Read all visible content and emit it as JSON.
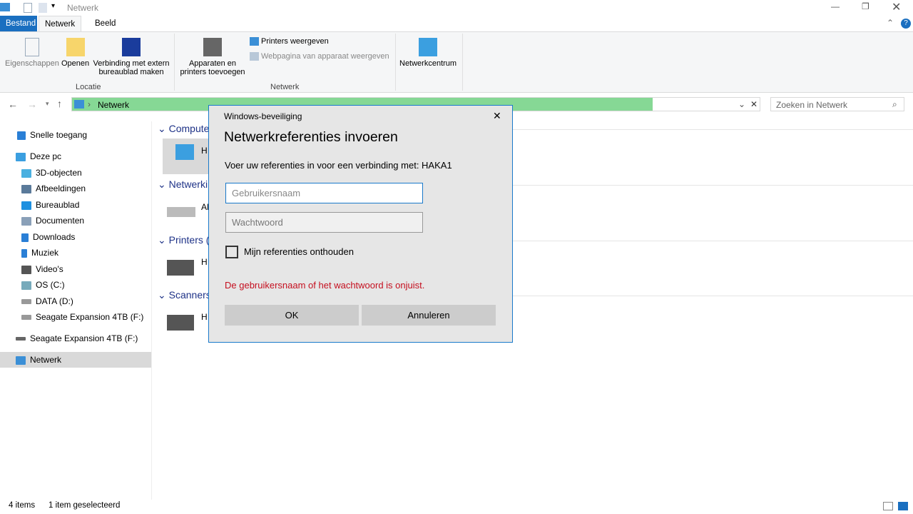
{
  "window": {
    "title": "Netwerk"
  },
  "tabs": [
    {
      "label": "Bestand"
    },
    {
      "label": "Netwerk"
    },
    {
      "label": "Beeld"
    }
  ],
  "ribbon": {
    "locatie": {
      "label": "Locatie",
      "buttons": [
        {
          "label": "Eigenschappen"
        },
        {
          "label": "Openen"
        },
        {
          "label": "Verbinding met extern bureaublad maken"
        }
      ]
    },
    "netwerk": {
      "label": "Netwerk",
      "add_devices": "Apparaten en printers toevoegen",
      "show_printers": "Printers weergeven",
      "device_webpage": "Webpagina van apparaat weergeven"
    },
    "netwerkcentrum": "Netwerkcentrum"
  },
  "address": {
    "path": "Netwerk",
    "search_placeholder": "Zoeken in Netwerk"
  },
  "sidebar": {
    "items": [
      {
        "label": "Snelle toegang"
      },
      {
        "label": "Deze pc"
      },
      {
        "label": "3D-objecten"
      },
      {
        "label": "Afbeeldingen"
      },
      {
        "label": "Bureaublad"
      },
      {
        "label": "Documenten"
      },
      {
        "label": "Downloads"
      },
      {
        "label": "Muziek"
      },
      {
        "label": "Video's"
      },
      {
        "label": "OS (C:)"
      },
      {
        "label": "DATA (D:)"
      },
      {
        "label": "Seagate Expansion 4TB (F:)"
      },
      {
        "label": "Seagate Expansion 4TB (F:)"
      },
      {
        "label": "Netwerk"
      }
    ]
  },
  "content": {
    "sections": [
      {
        "label": "Compute",
        "item": "H"
      },
      {
        "label": "Netwerki",
        "item": "Al"
      },
      {
        "label": "Printers (",
        "item": "H"
      },
      {
        "label": "Scanners",
        "item": "H"
      }
    ]
  },
  "dialog": {
    "app": "Windows-beveiliging",
    "title": "Netwerkreferenties invoeren",
    "message": "Voer uw referenties in voor een verbinding met: HAKA1",
    "username_placeholder": "Gebruikersnaam",
    "password_placeholder": "Wachtwoord",
    "remember": "Mijn referenties onthouden",
    "error": "De gebruikersnaam of het wachtwoord is onjuist.",
    "ok": "OK",
    "cancel": "Annuleren",
    "error_color": "#c50f1f"
  },
  "status": {
    "count": "4 items",
    "selected": "1 item geselecteerd"
  }
}
